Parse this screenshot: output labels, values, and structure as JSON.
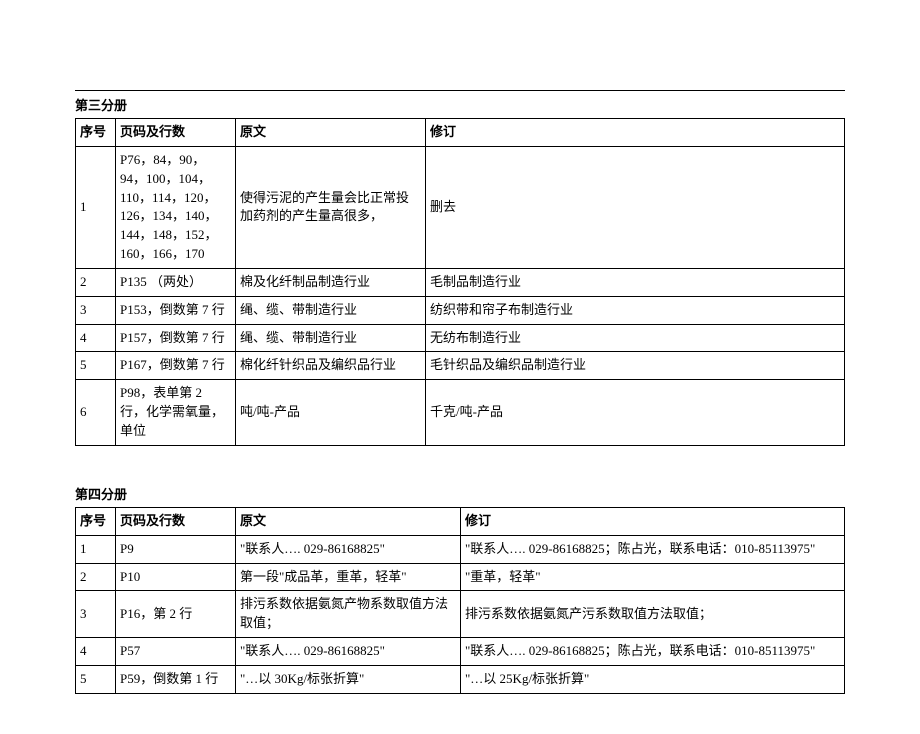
{
  "section3": {
    "title": "第三分册",
    "headers": {
      "seq": "序号",
      "page": "页码及行数",
      "original": "原文",
      "revision": "修订"
    },
    "rows": [
      {
        "seq": "1",
        "page": "P76，84，90，94，100，104，110，114，120，126，134，140，144，148，152，160，166，170",
        "original": "使得污泥的产生量会比正常投加药剂的产生量高很多，",
        "revision": "删去"
      },
      {
        "seq": "2",
        "page": "P135 （两处）",
        "original": "棉及化纤制品制造行业",
        "revision": "毛制品制造行业"
      },
      {
        "seq": "3",
        "page": "P153，倒数第 7 行",
        "original": "绳、缆、带制造行业",
        "revision": "纺织带和帘子布制造行业"
      },
      {
        "seq": "4",
        "page": "P157，倒数第 7 行",
        "original": "绳、缆、带制造行业",
        "revision": "无纺布制造行业"
      },
      {
        "seq": "5",
        "page": "P167，倒数第 7 行",
        "original": "棉化纤针织品及编织品行业",
        "revision": "毛针织品及编织品制造行业"
      },
      {
        "seq": "6",
        "page": "P98，表单第 2 行，化学需氧量，单位",
        "original": "吨/吨-产品",
        "revision": "千克/吨-产品"
      }
    ]
  },
  "section4": {
    "title": "第四分册",
    "headers": {
      "seq": "序号",
      "page": "页码及行数",
      "original": "原文",
      "revision": "修订"
    },
    "rows": [
      {
        "seq": "1",
        "page": "P9",
        "original": "\"联系人…. 029-86168825\"",
        "revision": "\"联系人…. 029-86168825；陈占光，联系电话：010-85113975\""
      },
      {
        "seq": "2",
        "page": "P10",
        "original": "第一段\"成品革，重革，轻革\"",
        "revision": "\"重革，轻革\""
      },
      {
        "seq": "3",
        "page": "P16，第 2 行",
        "original": "排污系数依据氨氮产物系数取值方法取值；",
        "revision": "排污系数依据氨氮产污系数取值方法取值；"
      },
      {
        "seq": "4",
        "page": "P57",
        "original": "\"联系人…. 029-86168825\"",
        "revision": "\"联系人…. 029-86168825；陈占光，联系电话：010-85113975\""
      },
      {
        "seq": "5",
        "page": "P59，倒数第 1 行",
        "original": "\"…以 30Kg/标张折算\"",
        "revision": "\"…以 25Kg/标张折算\""
      }
    ]
  }
}
